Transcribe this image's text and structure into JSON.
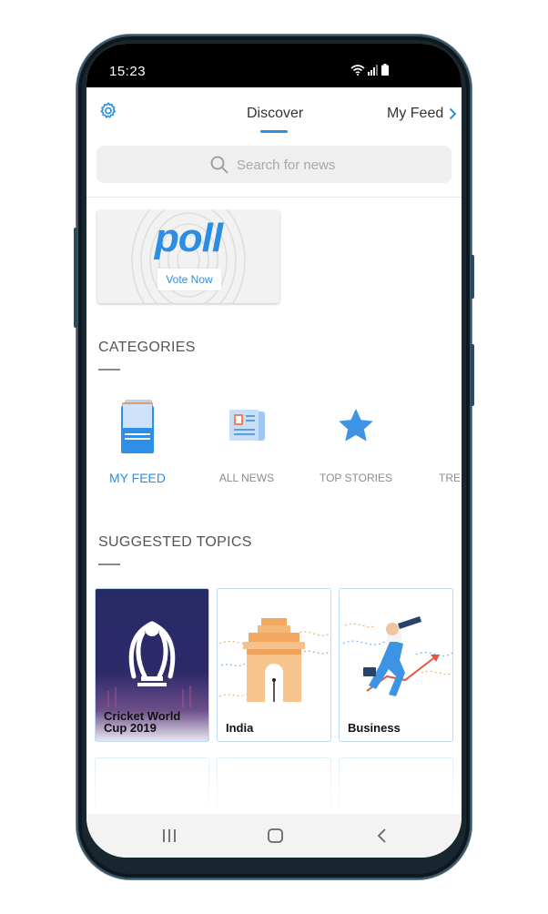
{
  "status": {
    "time": "15:23"
  },
  "header": {
    "tab_discover": "Discover",
    "tab_myfeed": "My Feed"
  },
  "search": {
    "placeholder": "Search for news"
  },
  "poll": {
    "title": "poll",
    "button": "Vote Now"
  },
  "categories": {
    "title": "CATEGORIES",
    "items": [
      {
        "label": "MY FEED",
        "icon": "my-feed-icon",
        "active": true
      },
      {
        "label": "ALL NEWS",
        "icon": "newspaper-icon",
        "active": false
      },
      {
        "label": "TOP STORIES",
        "icon": "star-icon",
        "active": false
      },
      {
        "label": "TRE",
        "icon": "trending-drop-icon",
        "active": false
      }
    ]
  },
  "topics": {
    "title": "SUGGESTED TOPICS",
    "items": [
      {
        "label": "Cricket World Cup 2019",
        "icon": "world-cup-trophy-icon"
      },
      {
        "label": "India",
        "icon": "india-gate-icon"
      },
      {
        "label": "Business",
        "icon": "businessman-telescope-icon"
      }
    ]
  },
  "navbar": {
    "recents": "recents-icon",
    "home": "home-icon",
    "back": "back-icon"
  },
  "colors": {
    "accent": "#2c8ee2",
    "frame": "#17262f"
  }
}
